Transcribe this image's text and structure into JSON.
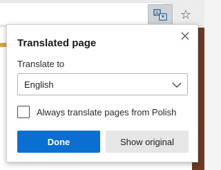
{
  "toolbar": {
    "translate_icon": "translate-icon",
    "favorite_icon": "star-icon",
    "favorite_glyph": "☆"
  },
  "popup": {
    "title": "Translated page",
    "close_icon": "close-icon",
    "translate_to_label": "Translate to",
    "language_select": {
      "selected": "English"
    },
    "always_translate": {
      "label": "Always translate pages from Polish",
      "checked": false
    },
    "done_label": "Done",
    "show_original_label": "Show original"
  },
  "colors": {
    "primary_button": "#0a6fd1",
    "secondary_button": "#e6e6e6",
    "translate_button_active": "#cfd3d8"
  }
}
